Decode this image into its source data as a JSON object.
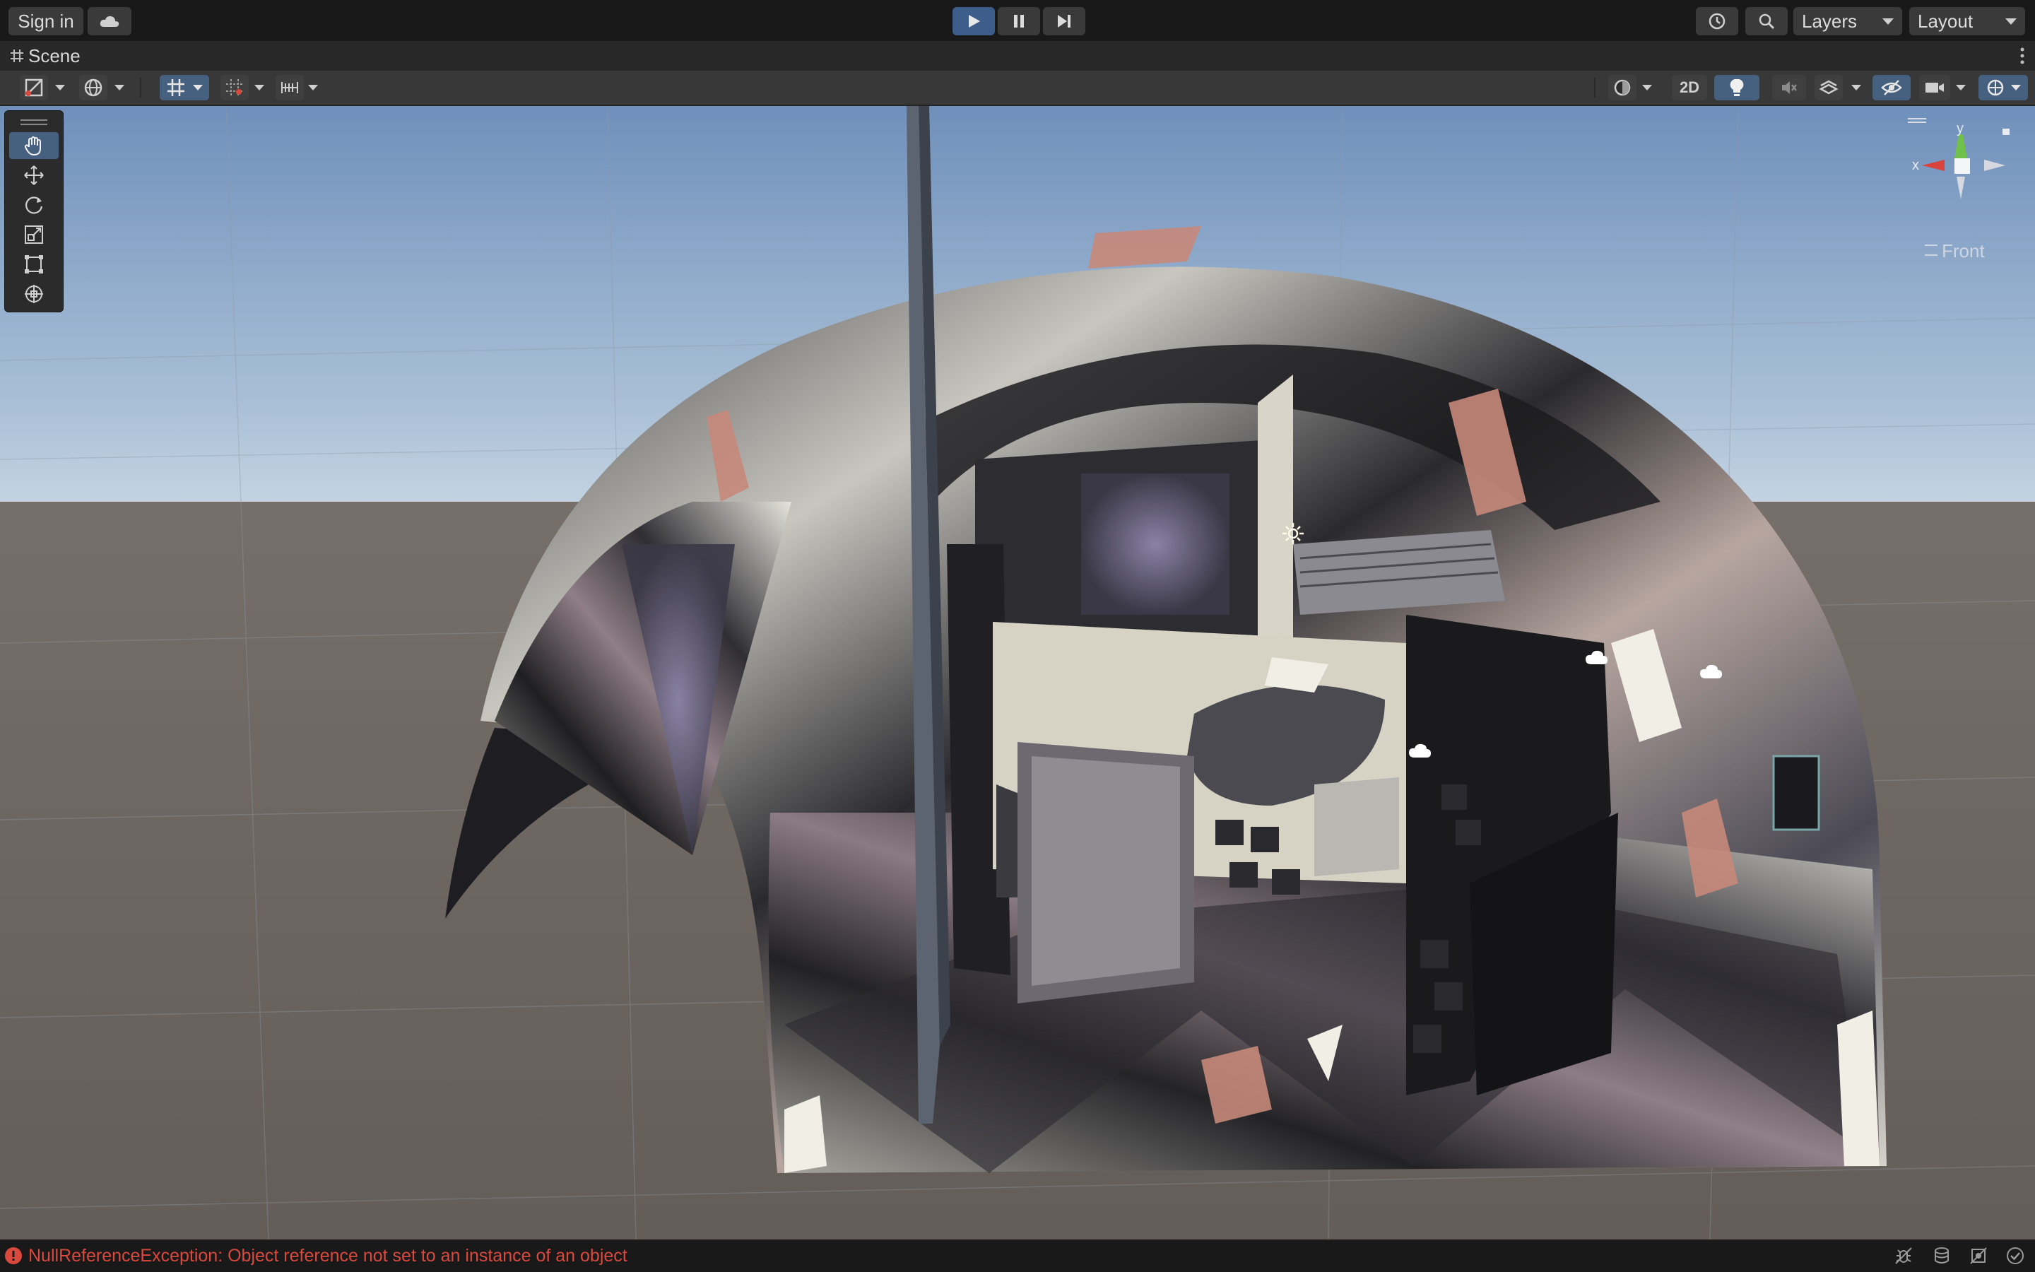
{
  "topbar": {
    "sign_in_label": "Sign in",
    "layers_label": "Layers",
    "layout_label": "Layout",
    "icons": [
      "cloud-icon",
      "play-icon",
      "pause-icon",
      "step-icon",
      "history-icon",
      "search-icon"
    ]
  },
  "scene_tab": {
    "title": "Scene"
  },
  "scene_toolbar": {
    "mode_2d_label": "2D",
    "icons": [
      "draw-mode-icon",
      "globe-icon",
      "grid-snap-icon",
      "snap-increment-icon",
      "ruler-icon",
      "shading-icon",
      "light-icon",
      "audio-mute-icon",
      "effects-icon",
      "visibility-icon",
      "camera-icon",
      "gizmos-icon"
    ]
  },
  "viewport": {
    "orientation_label": "Front",
    "gizmo_axis_x": "x",
    "gizmo_axis_y": "y",
    "tools": [
      "hand-tool-icon",
      "move-tool-icon",
      "rotate-tool-icon",
      "scale-tool-icon",
      "rect-tool-icon",
      "transform-tool-icon"
    ],
    "colors": {
      "sky_top": "#6f90bb",
      "sky_horizon": "#c3d3e2",
      "ground": "#6b645f",
      "accent_blue": "#46607f"
    }
  },
  "status": {
    "message": "NullReferenceException: Object reference not set to an instance of an object",
    "error_color": "#d9493e"
  }
}
